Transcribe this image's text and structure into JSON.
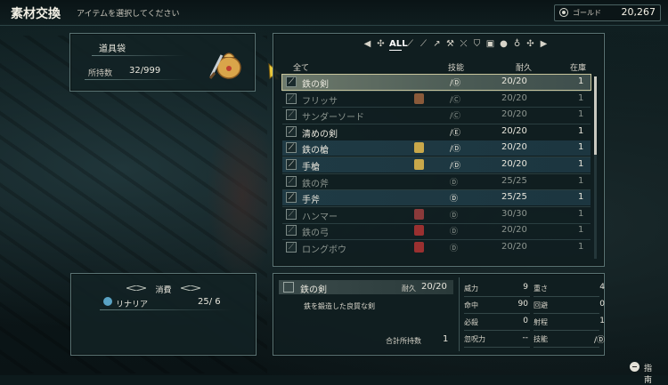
{
  "header": {
    "title": "素材交換",
    "subtitle": "アイテムを選択してください"
  },
  "gold": {
    "label": "ゴールド",
    "value": "20,267"
  },
  "bag": {
    "name": "道具袋",
    "count_label": "所持数",
    "count_value": "32/999"
  },
  "list": {
    "category_icons": [
      "arrow-left-icon",
      "gear-cluster-icon",
      "all-tab",
      "sword-icon",
      "lance-icon",
      "spear-icon",
      "axe-icon",
      "bow-icon",
      "shield-icon",
      "armor-icon",
      "bag-icon",
      "potion-icon",
      "gear-cluster-icon",
      "arrow-right-icon"
    ],
    "all_label": "ALL",
    "headers": {
      "name": "全て",
      "skill": "技能",
      "durability": "耐久",
      "stock": "在庫"
    },
    "items": [
      {
        "name": "鉄の剣",
        "skill": "/Ⓓ",
        "durability": "20/20",
        "stock": "1",
        "state": "selected",
        "flag": ""
      },
      {
        "name": "フリッサ",
        "skill": "/Ⓒ",
        "durability": "20/20",
        "stock": "1",
        "state": "dim",
        "flag": "#8a5a3a"
      },
      {
        "name": "サンダーソード",
        "skill": "/Ⓒ",
        "durability": "20/20",
        "stock": "1",
        "state": "dim",
        "flag": ""
      },
      {
        "name": "清めの剣",
        "skill": "/Ⓔ",
        "durability": "20/20",
        "stock": "1",
        "state": "normal",
        "flag": ""
      },
      {
        "name": "鉄の槍",
        "skill": "/Ⓓ",
        "durability": "20/20",
        "stock": "1",
        "state": "hi",
        "flag": "#c9a84a"
      },
      {
        "name": "手槍",
        "skill": "/Ⓓ",
        "durability": "20/20",
        "stock": "1",
        "state": "hi",
        "flag": "#c9a84a"
      },
      {
        "name": "鉄の斧",
        "skill": "Ⓓ",
        "durability": "25/25",
        "stock": "1",
        "state": "dim",
        "flag": ""
      },
      {
        "name": "手斧",
        "skill": "Ⓓ",
        "durability": "25/25",
        "stock": "1",
        "state": "hi",
        "flag": ""
      },
      {
        "name": "ハンマー",
        "skill": "Ⓓ",
        "durability": "30/30",
        "stock": "1",
        "state": "dim",
        "flag": "#8a3a3a"
      },
      {
        "name": "鉄の弓",
        "skill": "Ⓓ",
        "durability": "20/20",
        "stock": "1",
        "state": "dim",
        "flag": "#9a3030"
      },
      {
        "name": "ロングボウ",
        "skill": "Ⓓ",
        "durability": "20/20",
        "stock": "1",
        "state": "dim",
        "flag": "#9a3030"
      }
    ]
  },
  "consume": {
    "title": "消費",
    "item_name": "リナリア",
    "item_qty": "25/ 6"
  },
  "detail": {
    "name": "鉄の剣",
    "dur_label": "耐久",
    "dur_value": "20/20",
    "description": "鉄を鍛造した良質な剣",
    "total_label": "合計所持数",
    "total_value": "1",
    "stats": [
      {
        "label": "威力",
        "value": "9"
      },
      {
        "label": "重さ",
        "value": "4"
      },
      {
        "label": "命中",
        "value": "90"
      },
      {
        "label": "回避",
        "value": "0"
      },
      {
        "label": "必殺",
        "value": "0"
      },
      {
        "label": "射程",
        "value": "1"
      },
      {
        "label": "忽呪力",
        "value": "--"
      },
      {
        "label": "技能",
        "value": "/Ⓓ"
      }
    ]
  },
  "guide": {
    "label": "指南"
  }
}
